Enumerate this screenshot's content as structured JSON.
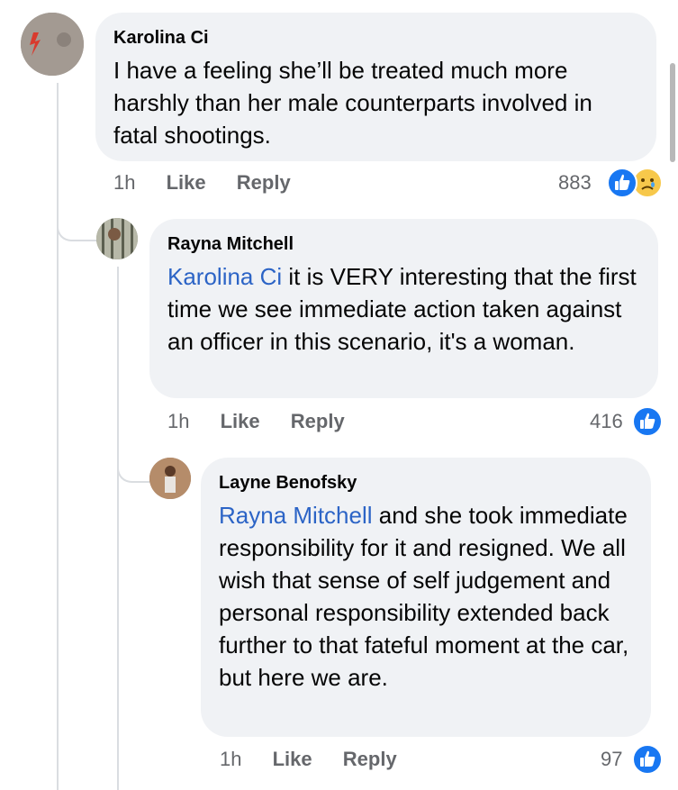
{
  "comments": [
    {
      "author": "Karolina Ci",
      "text": "I have a feeling she’ll be treated much more harshly than her male counterparts involved in fatal shootings.",
      "time": "1h",
      "like_label": "Like",
      "reply_label": "Reply",
      "reaction_count": "883",
      "reactions": [
        "like-icon",
        "sad-icon"
      ]
    },
    {
      "author": "Rayna Mitchell",
      "mention": "Karolina Ci",
      "text": " it is VERY interesting that the first time we see immediate action taken against an officer in this scenario, it's a woman.",
      "time": "1h",
      "like_label": "Like",
      "reply_label": "Reply",
      "reaction_count": "416",
      "reactions": [
        "like-icon"
      ]
    },
    {
      "author": "Layne Benofsky",
      "mention": "Rayna Mitchell",
      "text": " and she took immediate responsibility for it and resigned. We all wish that sense of self judgement and personal responsibility extended back further to that fateful moment at the car, but here we are.",
      "time": "1h",
      "like_label": "Like",
      "reply_label": "Reply",
      "reaction_count": "97",
      "reactions": [
        "like-icon"
      ]
    }
  ],
  "colors": {
    "bubble": "#f0f2f5",
    "mention": "#2c64c6",
    "like_blue": "#1877f2",
    "meta_grey": "#65676b"
  }
}
